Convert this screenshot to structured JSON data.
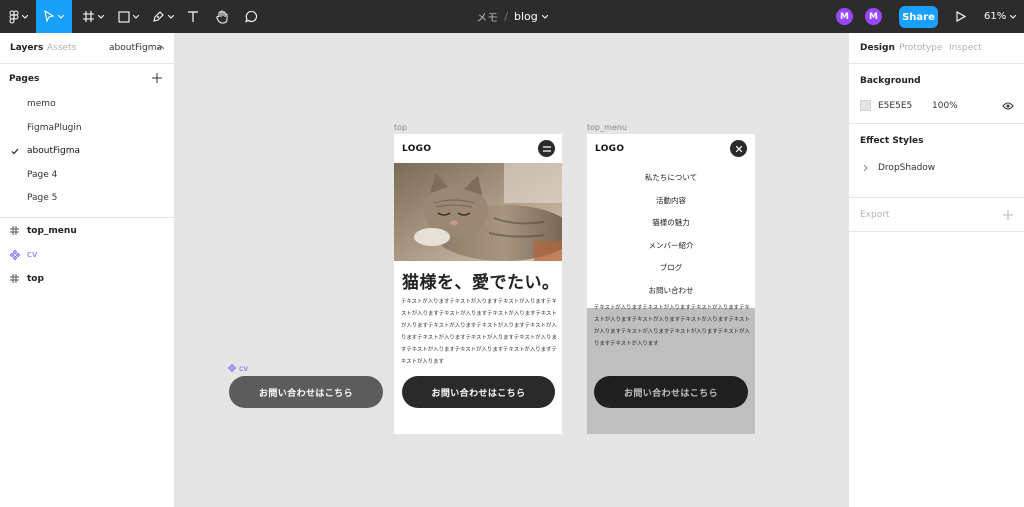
{
  "toolbar": {
    "project": "メモ",
    "separator": "/",
    "file_name": "blog",
    "avatars": [
      "M",
      "M"
    ],
    "share_label": "Share",
    "zoom_label": "61%",
    "icons": [
      "figma-menu-icon",
      "move-tool-icon",
      "frame-tool-icon",
      "shape-tool-icon",
      "pen-tool-icon",
      "text-tool-icon",
      "hand-tool-icon",
      "comment-tool-icon",
      "present-icon"
    ]
  },
  "left_panel": {
    "tabs": [
      "Layers",
      "Assets"
    ],
    "page_switcher": "aboutFigma",
    "pages_heading": "Pages",
    "pages": [
      "memo",
      "FigmaPlugin",
      "aboutFigma",
      "Page 4",
      "Page 5"
    ],
    "current_page": "aboutFigma",
    "layers": [
      {
        "name": "top_menu",
        "type": "frame"
      },
      {
        "name": "cv",
        "type": "component"
      },
      {
        "name": "top",
        "type": "frame"
      }
    ]
  },
  "right_panel": {
    "tabs": [
      "Design",
      "Prototype",
      "Inspect"
    ],
    "background_heading": "Background",
    "background_hex": "E5E5E5",
    "background_opacity": "100%",
    "effect_styles_heading": "Effect Styles",
    "effect_style": "DropShadow",
    "export_heading": "Export"
  },
  "canvas": {
    "background_color": "#e5e5e5",
    "component_label": "cv",
    "component_button": "お問い合わせはこちら",
    "top_frame": {
      "label": "top",
      "logo": "LOGO",
      "headline": "猫様を、愛でたい。",
      "body": "テキストが入りますテキストが入りますテキストが入りますテキストが入りますテキストが入りますテキストが入りますテキストが入りますテキストが入りますテキストが入りますテキストが入りますテキストが入りますテキストが入りますテキストが入りますテキストが入りますテキストが入りますテキストが入りますテキストが入ります",
      "cta": "お問い合わせはこちら"
    },
    "top_menu_frame": {
      "label": "top_menu",
      "logo": "LOGO",
      "menu_items": [
        "私たちについて",
        "活動内容",
        "猫様の魅力",
        "メンバー紹介",
        "ブログ",
        "お問い合わせ"
      ],
      "body": "テキストが入りますテキストが入りますテキストが入りますテキストが入りますテキストが入りますテキストが入りますテキストが入りますテキストが入りますテキストが入りますテキストが入りますテキストが入ります",
      "cta": "お問い合わせはこちら"
    }
  },
  "colors": {
    "toolbar": "#2c2c2c",
    "accent": "#18a0fb",
    "avatar": "#9747ff",
    "component": "#7b61ff",
    "dark_button": "#2a2a2a"
  }
}
